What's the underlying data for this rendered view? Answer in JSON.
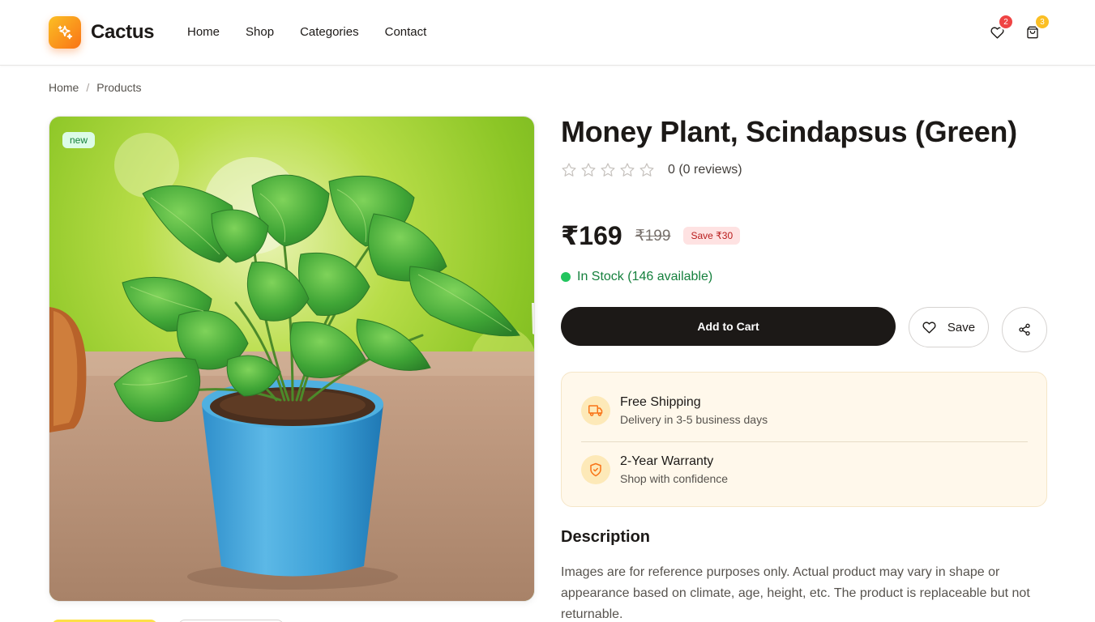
{
  "top_progress": {
    "fraction": 0.2
  },
  "brand": {
    "name": "Cactus",
    "logo_icon": "sparkle-icon",
    "gradient": [
      "#fbbf24",
      "#f97316"
    ]
  },
  "nav": {
    "items": [
      {
        "label": "Home"
      },
      {
        "label": "Shop"
      },
      {
        "label": "Categories"
      },
      {
        "label": "Contact"
      }
    ]
  },
  "header_actions": {
    "wishlist": {
      "icon": "heart-icon",
      "count": "2",
      "badge_color": "#ef4444"
    },
    "cart": {
      "icon": "shopping-bag-icon",
      "count": "3",
      "badge_color": "#fbbf24"
    }
  },
  "breadcrumb": {
    "items": [
      "Home",
      "Products"
    ],
    "separator": "/"
  },
  "product": {
    "image_alt_icon": "plant-photo",
    "tag": "new",
    "title": "Money Plant, Scindapsus (Green)",
    "rating": {
      "stars_filled": 0,
      "stars_total": 5,
      "text": "0 (0 reviews)"
    },
    "price": "₹169",
    "original_price": "₹199",
    "discount_label": "Save ₹30",
    "stock": {
      "text": "In Stock (146 available)",
      "color": "#22c55e"
    }
  },
  "actions": {
    "add_to_cart": "Add to Cart",
    "save": "Save",
    "share_icon": "share-icon"
  },
  "benefits": [
    {
      "icon": "truck-icon",
      "title": "Free Shipping",
      "subtitle": "Delivery in 3-5 business days"
    },
    {
      "icon": "shield-check-icon",
      "title": "2-Year Warranty",
      "subtitle": "Shop with confidence"
    }
  ],
  "description": {
    "heading": "Description",
    "body": "Images are for reference purposes only. Actual product may vary in shape or appearance based on climate, age, height, etc. The product is replaceable but not returnable."
  },
  "colors": {
    "primary": "#1c1917",
    "accent": "#f97316",
    "stock_green": "#15803d",
    "benefit_bg": "#fff8eb"
  }
}
